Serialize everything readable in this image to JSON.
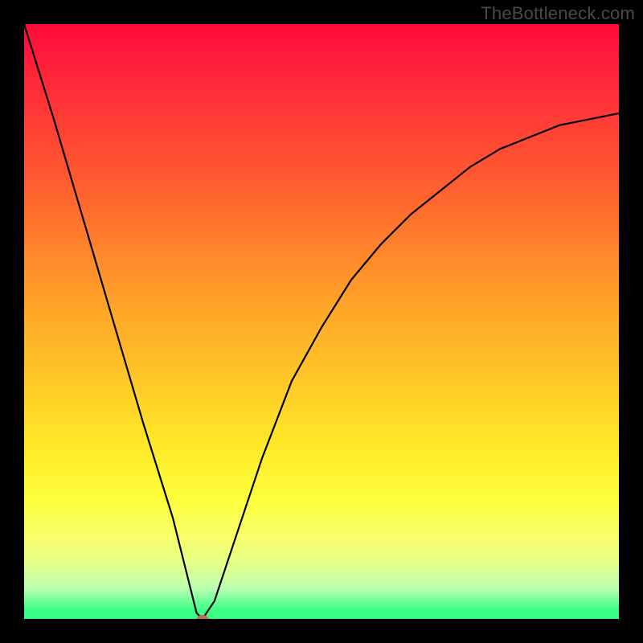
{
  "watermark": "TheBottleneck.com",
  "chart_data": {
    "type": "line",
    "title": "",
    "xlabel": "",
    "ylabel": "",
    "xlim": [
      0,
      100
    ],
    "ylim": [
      0,
      100
    ],
    "grid": false,
    "legend": false,
    "series": [
      {
        "name": "bottleneck-curve",
        "x": [
          0,
          5,
          10,
          15,
          20,
          25,
          29,
          30,
          32,
          35,
          40,
          45,
          50,
          55,
          60,
          65,
          70,
          75,
          80,
          85,
          90,
          95,
          100
        ],
        "values": [
          100,
          84,
          67,
          50,
          33,
          17,
          1,
          0,
          3,
          12,
          27,
          40,
          49,
          57,
          63,
          68,
          72,
          76,
          79,
          81,
          83,
          84,
          85
        ]
      }
    ],
    "marker": {
      "x": 30,
      "y": 0,
      "color": "#c96b55"
    },
    "background_gradient": {
      "orientation": "vertical",
      "stops": [
        {
          "pos": 0.0,
          "color": "#ff0a3a"
        },
        {
          "pos": 0.25,
          "color": "#ff5730"
        },
        {
          "pos": 0.5,
          "color": "#ffb028"
        },
        {
          "pos": 0.75,
          "color": "#fff030"
        },
        {
          "pos": 0.95,
          "color": "#c0ffa0"
        },
        {
          "pos": 1.0,
          "color": "#3aff85"
        }
      ]
    }
  }
}
